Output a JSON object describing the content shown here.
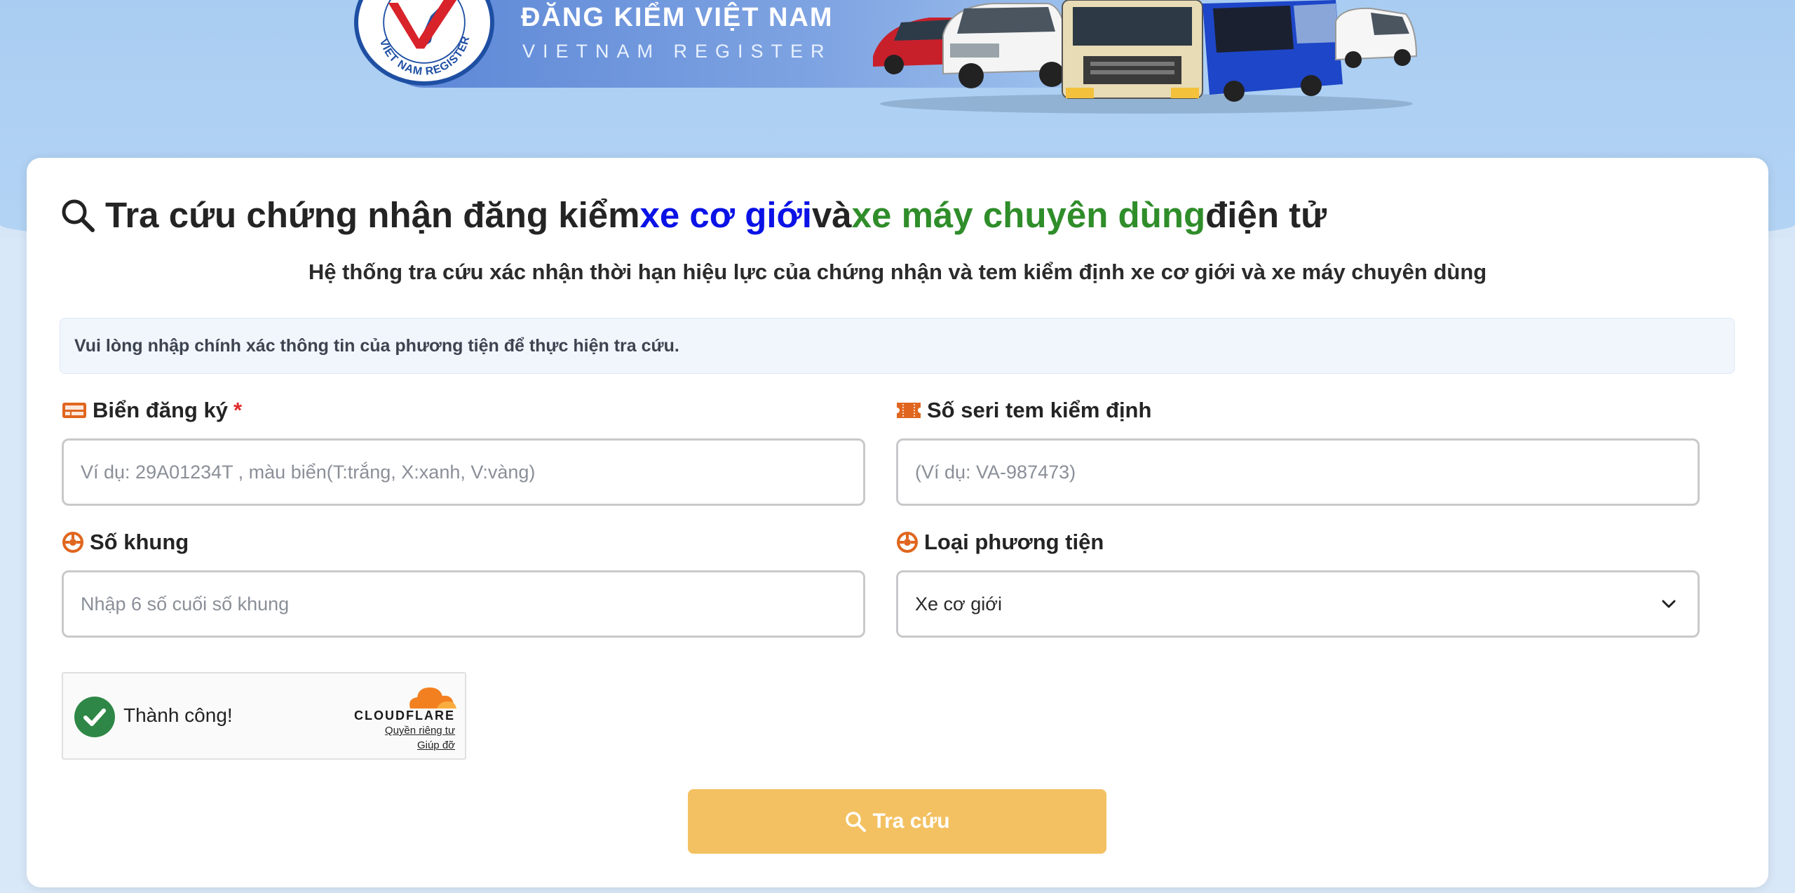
{
  "banner": {
    "brand_title": "ĐĂNG KIỂM VIỆT NAM",
    "brand_subtitle": "VIETNAM REGISTER",
    "logo_text": "VIET NAM REGISTER"
  },
  "page": {
    "title_prefix": "Tra cứu chứng nhận đăng kiểm ",
    "title_highlight_1": "xe cơ giới",
    "title_middle": " và ",
    "title_highlight_2": "xe máy chuyên dùng",
    "title_suffix": " điện tử",
    "subtitle": "Hệ thống tra cứu xác nhận thời hạn hiệu lực của chứng nhận và tem kiểm định xe cơ giới và xe máy chuyên dùng",
    "notice": "Vui lòng nhập chính xác thông tin của phương tiện để thực hiện tra cứu."
  },
  "form": {
    "plate": {
      "label": "Biển đăng ký",
      "required_mark": "*",
      "placeholder": "Ví dụ: 29A01234T , màu biển(T:trắng, X:xanh, V:vàng)",
      "value": ""
    },
    "serial": {
      "label": "Số seri tem kiểm định",
      "placeholder": "(Ví dụ: VA-987473)",
      "value": ""
    },
    "chassis": {
      "label": "Số khung",
      "placeholder": "Nhập 6 số cuối số khung",
      "value": ""
    },
    "vehicle_type": {
      "label": "Loại phương tiện",
      "selected": "Xe cơ giới"
    },
    "submit_label": "Tra cứu"
  },
  "captcha": {
    "status_text": "Thành công!",
    "brand": "CLOUDFLARE",
    "privacy_link": "Quyền riêng tư",
    "help_link": "Giúp đỡ"
  },
  "colors": {
    "accent_blue": "#0a12e6",
    "accent_green": "#2f8d2a",
    "button_yellow": "#f3c161",
    "icon_orange": "#e0661f",
    "required_red": "#e02a2a"
  }
}
